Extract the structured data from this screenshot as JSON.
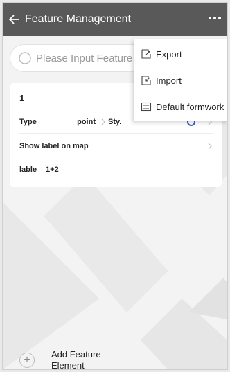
{
  "header": {
    "title": "Feature Management",
    "back_icon": "arrow-left-icon",
    "more_icon": "more-dots-icon"
  },
  "search": {
    "placeholder": "Please Input Feature",
    "icon": "search-icon"
  },
  "feature": {
    "name": "1",
    "type_label": "Type",
    "type_value": "point",
    "style_label": "Sty.",
    "show_label": "Show label on map",
    "lable_label": "lable",
    "lable_value": "1+2"
  },
  "menu": {
    "items": [
      {
        "label": "Export",
        "icon": "export-icon"
      },
      {
        "label": "Import",
        "icon": "import-icon"
      },
      {
        "label": "Default formwork",
        "icon": "list-icon"
      }
    ]
  },
  "add": {
    "label": "Add Feature Element",
    "icon": "plus-icon"
  },
  "colors": {
    "topbar": "#595959",
    "accent": "#3b5ccc"
  }
}
